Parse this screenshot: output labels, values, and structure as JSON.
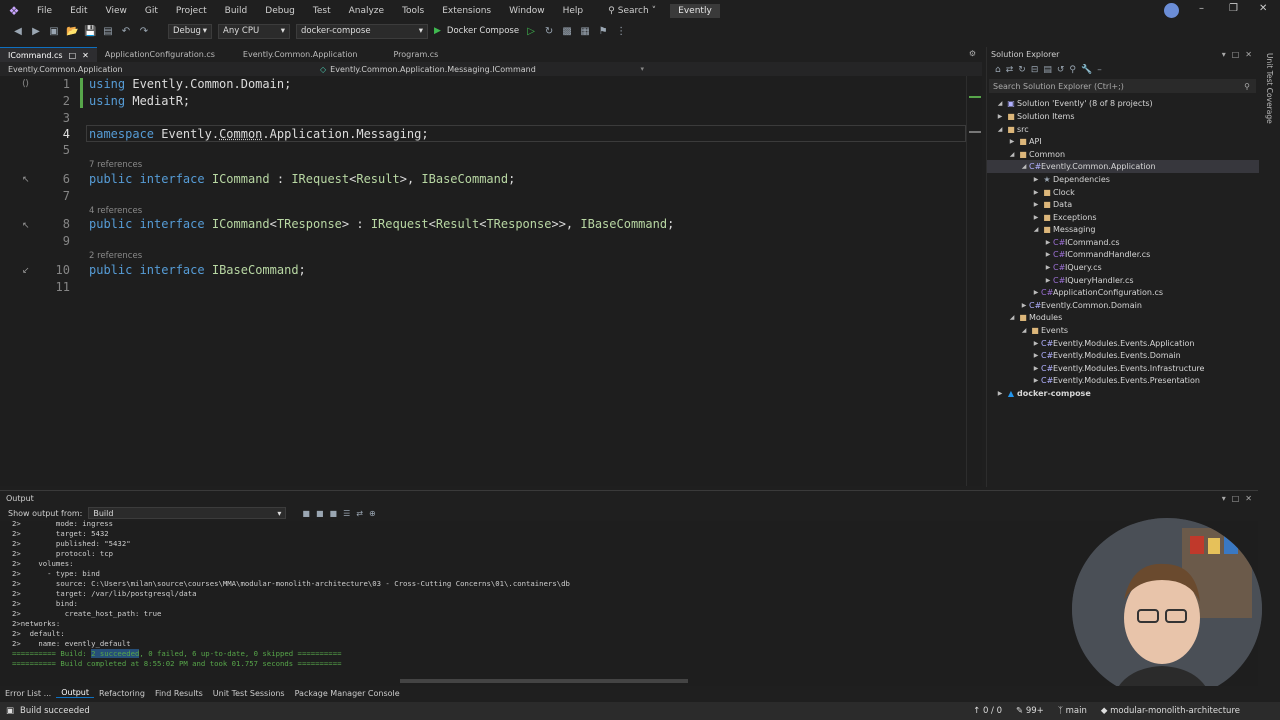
{
  "menu": {
    "items": [
      "File",
      "Edit",
      "View",
      "Git",
      "Project",
      "Build",
      "Debug",
      "Test",
      "Analyze",
      "Tools",
      "Extensions",
      "Window",
      "Help"
    ],
    "search_label": "Search",
    "solution_name": "Evently"
  },
  "toolbar": {
    "configuration": "Debug",
    "platform": "Any CPU",
    "startup_project": "docker-compose",
    "run_label": "Docker Compose"
  },
  "tabs": [
    {
      "label": "ICommand.cs",
      "active": true
    },
    {
      "label": "ApplicationConfiguration.cs",
      "active": false
    },
    {
      "label": "Evently.Common.Application",
      "active": false
    },
    {
      "label": "Program.cs",
      "active": false
    }
  ],
  "navbar": {
    "project": "Evently.Common.Application",
    "type": "Evently.Common.Application.Messaging.ICommand"
  },
  "code": {
    "line_numbers": [
      "1",
      "2",
      "3",
      "4",
      "5",
      "6",
      "7",
      "8",
      "9",
      "10",
      "11"
    ],
    "refs": [
      "7 references",
      "4 references",
      "2 references"
    ],
    "l1_kw": "using",
    "l1_rest": " Evently.Common.Domain;",
    "l2_kw": "using",
    "l2_rest": " MediatR;",
    "l4_kw": "namespace",
    "l4_a": " Evently.",
    "l4_b": "Common",
    "l4_c": ".Application.Messaging;",
    "l6_kw1": "public",
    "l6_kw2": " interface ",
    "l6_t1": "ICommand",
    "l6_rest1": " : ",
    "l6_t2": "IRequest",
    "l6_rest2": "<",
    "l6_t3": "Result",
    "l6_rest3": ">, ",
    "l6_t4": "IBaseCommand",
    "l6_end": ";",
    "l8_kw1": "public",
    "l8_kw2": " interface ",
    "l8_t1": "ICommand",
    "l8_rest1": "<",
    "l8_t2": "TResponse",
    "l8_rest2": "> : ",
    "l8_t3": "IRequest",
    "l8_rest3": "<",
    "l8_t4": "Result",
    "l8_rest4": "<",
    "l8_t5": "TResponse",
    "l8_rest5": ">>, ",
    "l8_t6": "IBaseCommand",
    "l8_end": ";",
    "l10_kw1": "public",
    "l10_kw2": " interface ",
    "l10_t1": "IBaseCommand",
    "l10_end": ";"
  },
  "solution_explorer": {
    "title": "Solution Explorer",
    "search_placeholder": "Search Solution Explorer (Ctrl+;)",
    "items": [
      {
        "label": "Solution 'Evently' (8 of 8 projects)",
        "icon": "solution-icon"
      },
      {
        "label": "Solution Items",
        "icon": "folder-icon"
      },
      {
        "label": "src",
        "icon": "folder-icon"
      },
      {
        "label": "API",
        "icon": "folder-icon"
      },
      {
        "label": "Common",
        "icon": "folder-icon"
      },
      {
        "label": "Evently.Common.Application",
        "icon": "project-icon"
      },
      {
        "label": "Dependencies",
        "icon": "dependencies-icon"
      },
      {
        "label": "Clock",
        "icon": "folder-icon"
      },
      {
        "label": "Data",
        "icon": "folder-icon"
      },
      {
        "label": "Exceptions",
        "icon": "folder-icon"
      },
      {
        "label": "Messaging",
        "icon": "folder-icon"
      },
      {
        "label": "ICommand.cs",
        "icon": "csharp-file-icon"
      },
      {
        "label": "ICommandHandler.cs",
        "icon": "csharp-file-icon"
      },
      {
        "label": "IQuery.cs",
        "icon": "csharp-file-icon"
      },
      {
        "label": "IQueryHandler.cs",
        "icon": "csharp-file-icon"
      },
      {
        "label": "ApplicationConfiguration.cs",
        "icon": "csharp-file-icon"
      },
      {
        "label": "Evently.Common.Domain",
        "icon": "project-icon"
      },
      {
        "label": "Modules",
        "icon": "folder-icon"
      },
      {
        "label": "Events",
        "icon": "folder-icon"
      },
      {
        "label": "Evently.Modules.Events.Application",
        "icon": "project-icon"
      },
      {
        "label": "Evently.Modules.Events.Domain",
        "icon": "project-icon"
      },
      {
        "label": "Evently.Modules.Events.Infrastructure",
        "icon": "project-icon"
      },
      {
        "label": "Evently.Modules.Events.Presentation",
        "icon": "project-icon"
      },
      {
        "label": "docker-compose",
        "icon": "docker-icon"
      }
    ]
  },
  "side_strip": {
    "label": "Unit Test Coverage"
  },
  "output": {
    "title": "Output",
    "show_from_label": "Show output from:",
    "show_from_value": "Build",
    "lines": [
      "2>        mode: ingress",
      "2>        target: 5432",
      "2>        published: \"5432\"",
      "2>        protocol: tcp",
      "2>    volumes:",
      "2>      - type: bind",
      "2>        source: C:\\Users\\milan\\source\\courses\\MMA\\modular-monolith-architecture\\03 - Cross-Cutting Concerns\\01\\.containers\\db",
      "2>        target: /var/lib/postgresql/data",
      "2>        bind:",
      "2>          create_host_path: true",
      "2>networks:",
      "2>  default:",
      "2>    name: evently_default"
    ],
    "build_line_a": "========== Build: ",
    "build_line_hl": "2 succeeded",
    "build_line_b": ", 0 failed, 6 up-to-date, 0 skipped ==========",
    "completed_line": "========== Build completed at 8:55:02 PM and took 01.757 seconds =========="
  },
  "bottom_tabs": [
    "Error List ...",
    "Output",
    "Refactoring",
    "Find Results",
    "Unit Test Sessions",
    "Package Manager Console"
  ],
  "status": {
    "message": "Build succeeded",
    "errors": "0 / 0",
    "changes": "99+",
    "branch": "main",
    "repo": "modular-monolith-architecture"
  }
}
